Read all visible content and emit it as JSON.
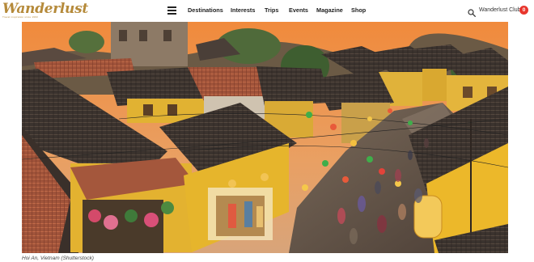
{
  "brand": {
    "name": "Wanderlust",
    "tagline": "Travel inspiration since 1993"
  },
  "header": {
    "menu_icon": "hamburger-menu-icon",
    "nav": [
      {
        "label": "Destinations"
      },
      {
        "label": "Interests"
      },
      {
        "label": "Trips"
      },
      {
        "label": "Events"
      },
      {
        "label": "Magazine"
      },
      {
        "label": "Shop"
      }
    ],
    "search_icon": "magnifier-icon",
    "club_label": "Wanderlust Club",
    "club_badge": "0"
  },
  "hero": {
    "image_subject": "old town street with yellow houses and lanterns at dusk",
    "caption": "Hoi An, Vietnam (Shutterstock)"
  },
  "colors": {
    "brand_gold": "#b58a3a",
    "badge_red": "#e8362d",
    "wall_yellow": "#e6b62a",
    "roof_dark": "#3d3530",
    "sky_orange": "#e8884a"
  }
}
